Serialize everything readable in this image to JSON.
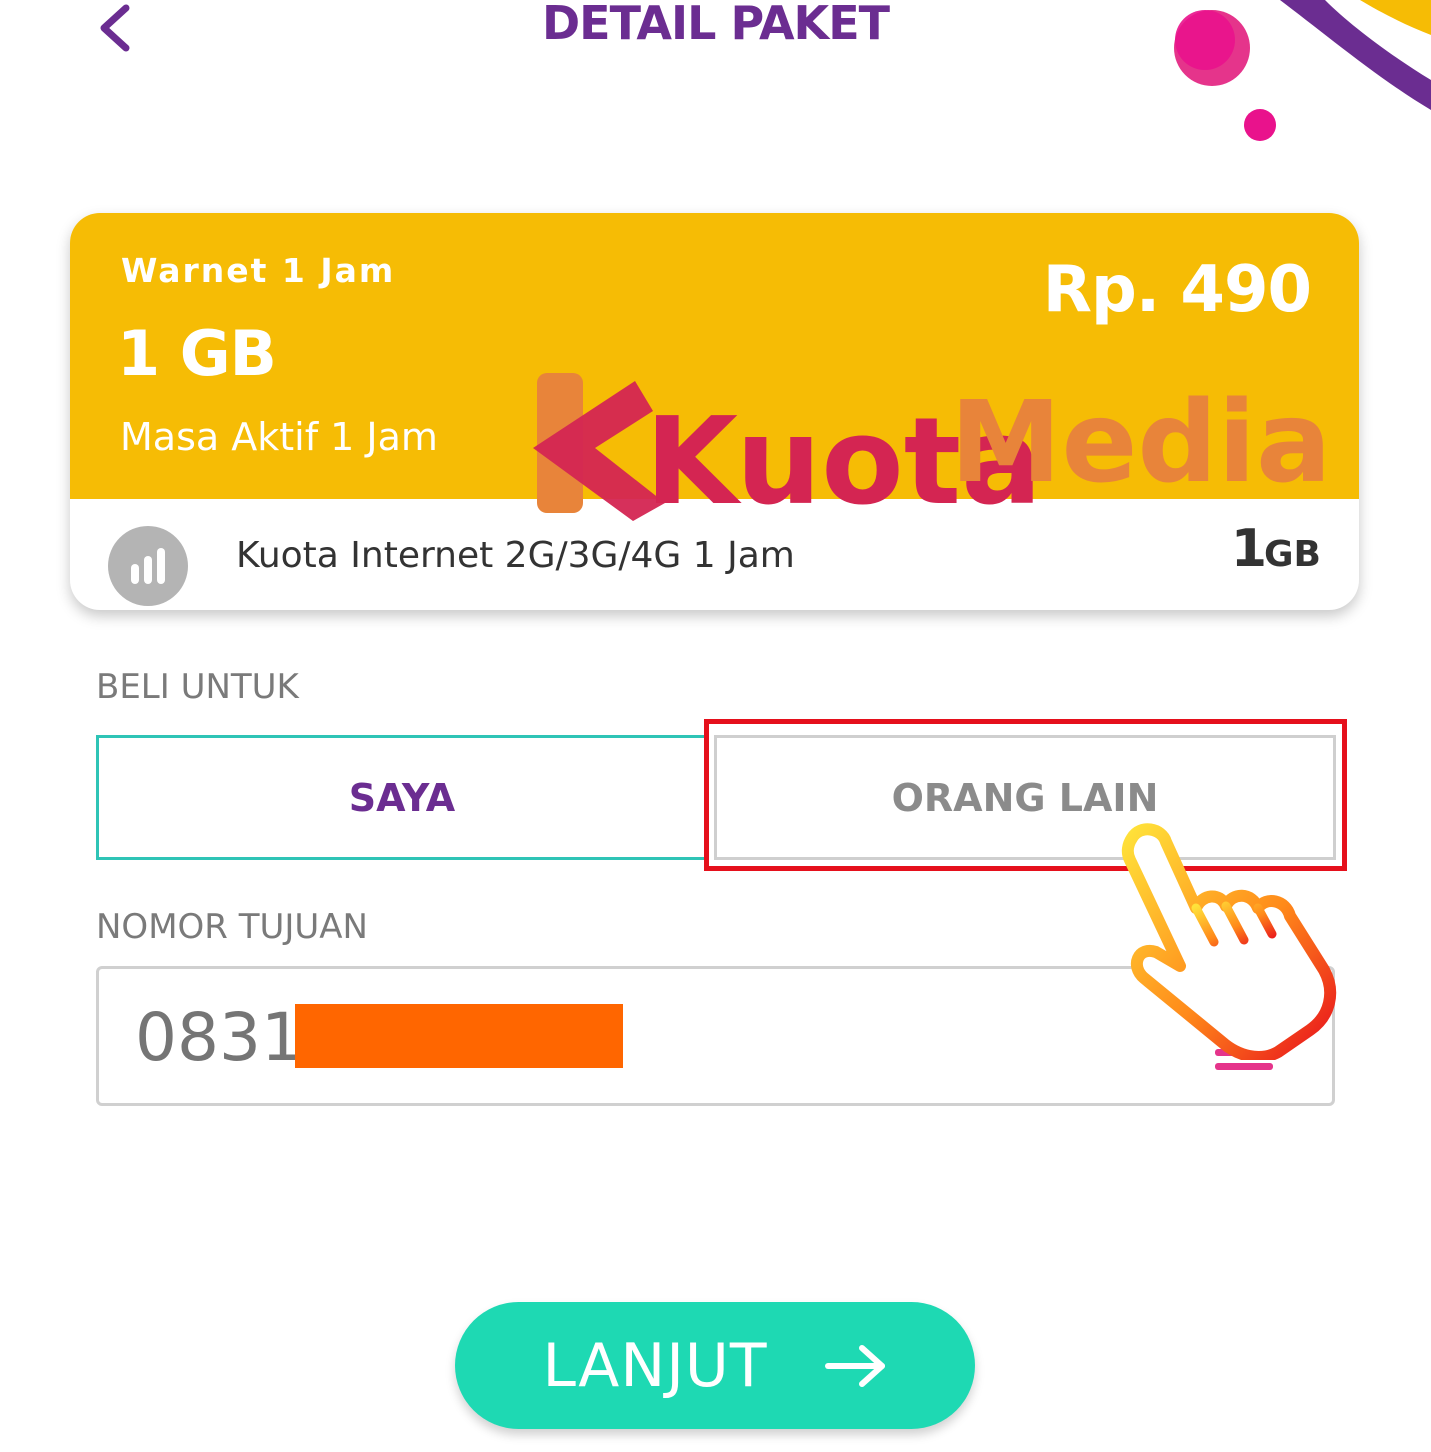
{
  "header": {
    "back_icon": "chevron-left-icon",
    "title": "DETAIL PAKET"
  },
  "package": {
    "name": "Warnet 1 Jam",
    "size": "1 GB",
    "active_period": "Masa Aktif 1 Jam",
    "price": "Rp. 490",
    "quota_icon": "signal-bars-icon",
    "quota_label": "Kuota Internet 2G/3G/4G 1 Jam",
    "quota_amount": "1",
    "quota_unit": "GB"
  },
  "watermark": {
    "text_part1": "Kuota",
    "text_part2": "Media"
  },
  "buy_for": {
    "label": "BELI UNTUK",
    "options": [
      "SAYA",
      "ORANG LAIN"
    ],
    "selected": "SAYA"
  },
  "destination": {
    "label": "NOMOR TUJUAN",
    "value": "0831",
    "contact_icon": "contact-list-icon"
  },
  "continue_button": {
    "label": "LANJUT",
    "icon": "arrow-right-icon"
  },
  "colors": {
    "brand_purple": "#6b2d91",
    "card_yellow": "#f6bc05",
    "accent_teal": "#1ed9b3",
    "selected_border": "#2ec4b6",
    "annotation_red": "#e5101c",
    "redaction_orange": "#ff6600"
  }
}
